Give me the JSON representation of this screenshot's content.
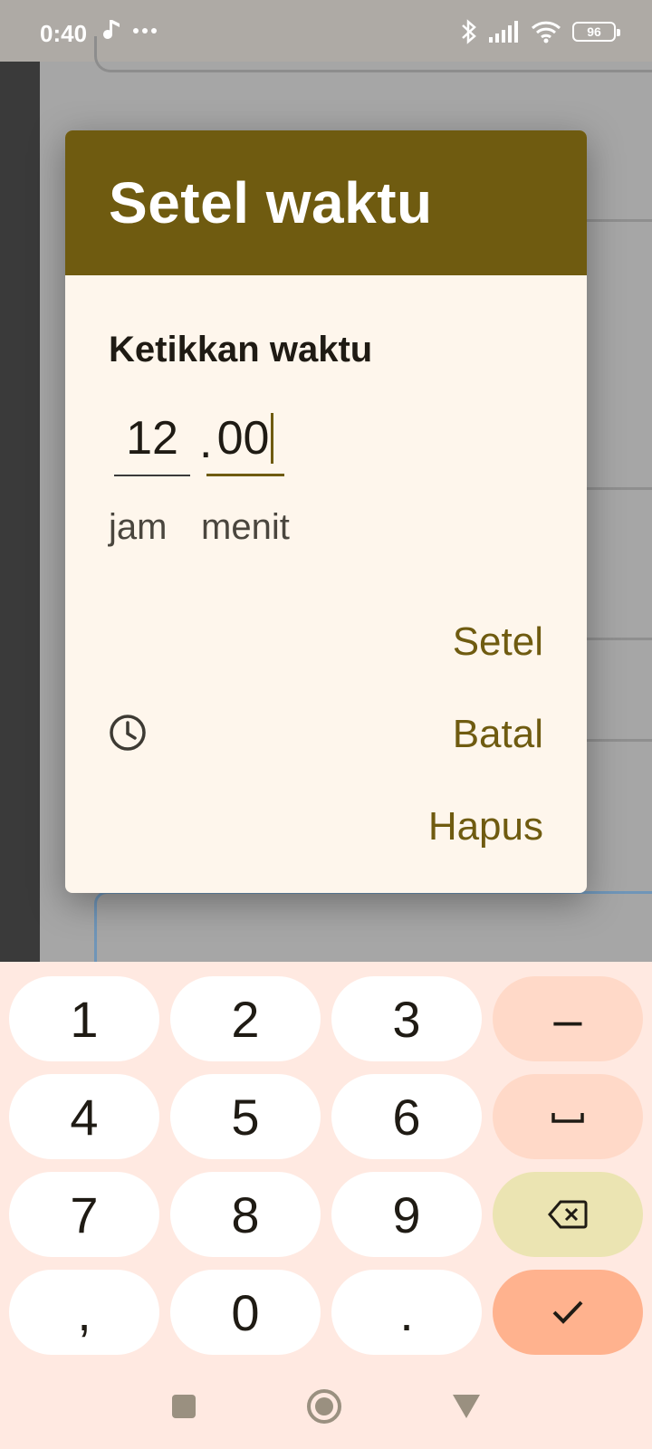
{
  "status_bar": {
    "time": "0:40",
    "battery": "96"
  },
  "dialog": {
    "title": "Setel waktu",
    "subtitle": "Ketikkan waktu",
    "hour_value": "12",
    "separator": ".",
    "minute_value": "00",
    "hour_label": "jam",
    "minute_label": "menit",
    "actions": {
      "set": "Setel",
      "cancel": "Batal",
      "clear": "Hapus"
    }
  },
  "keyboard": {
    "keys": [
      "1",
      "2",
      "3",
      "–",
      "4",
      "5",
      "6",
      "␣",
      "7",
      "8",
      "9",
      "⌫",
      ",",
      "0",
      ".",
      "✓"
    ]
  },
  "colors": {
    "header": "#6f5b10",
    "dialog_bg": "#fef6ec",
    "keyboard_bg": "#ffe9e1",
    "accent": "#6f5b10"
  }
}
